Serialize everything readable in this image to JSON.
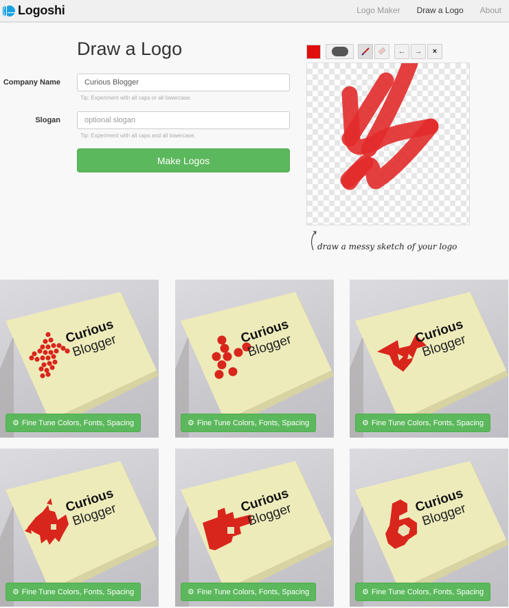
{
  "navbar": {
    "brand": "Logoshi",
    "links": [
      {
        "label": "Logo Maker",
        "active": false
      },
      {
        "label": "Draw a Logo",
        "active": true
      },
      {
        "label": "About",
        "active": false
      }
    ]
  },
  "form": {
    "title": "Draw a Logo",
    "company_label": "Company Name",
    "company_value": "Curious Blogger",
    "company_tip": "Tip: Experiment with all caps or all lowercase.",
    "slogan_label": "Slogan",
    "slogan_placeholder": "optional slogan",
    "slogan_value": "",
    "slogan_tip": "Tip: Experiment with all caps and all lowercase.",
    "submit_label": "Make Logos"
  },
  "drawing": {
    "color": "#e10e0e",
    "tools": {
      "color_icon": "color-swatch",
      "brush_size_icon": "brush-size",
      "pencil_icon": "pencil-icon",
      "eraser_icon": "eraser-icon",
      "undo_label": "←",
      "redo_label": "→",
      "clear_label": "×"
    },
    "hint": "draw a messy sketch of your logo"
  },
  "results": {
    "company_line1": "Curious",
    "company_line2": "Blogger",
    "button_label": "Fine Tune Colors, Fonts, Spacing",
    "logo_color": "#d9261c",
    "items": [
      {
        "style": "dots-small"
      },
      {
        "style": "dots-large"
      },
      {
        "style": "triangles-geo"
      },
      {
        "style": "triangles-jagged"
      },
      {
        "style": "blocks"
      },
      {
        "style": "hexagons"
      }
    ]
  }
}
